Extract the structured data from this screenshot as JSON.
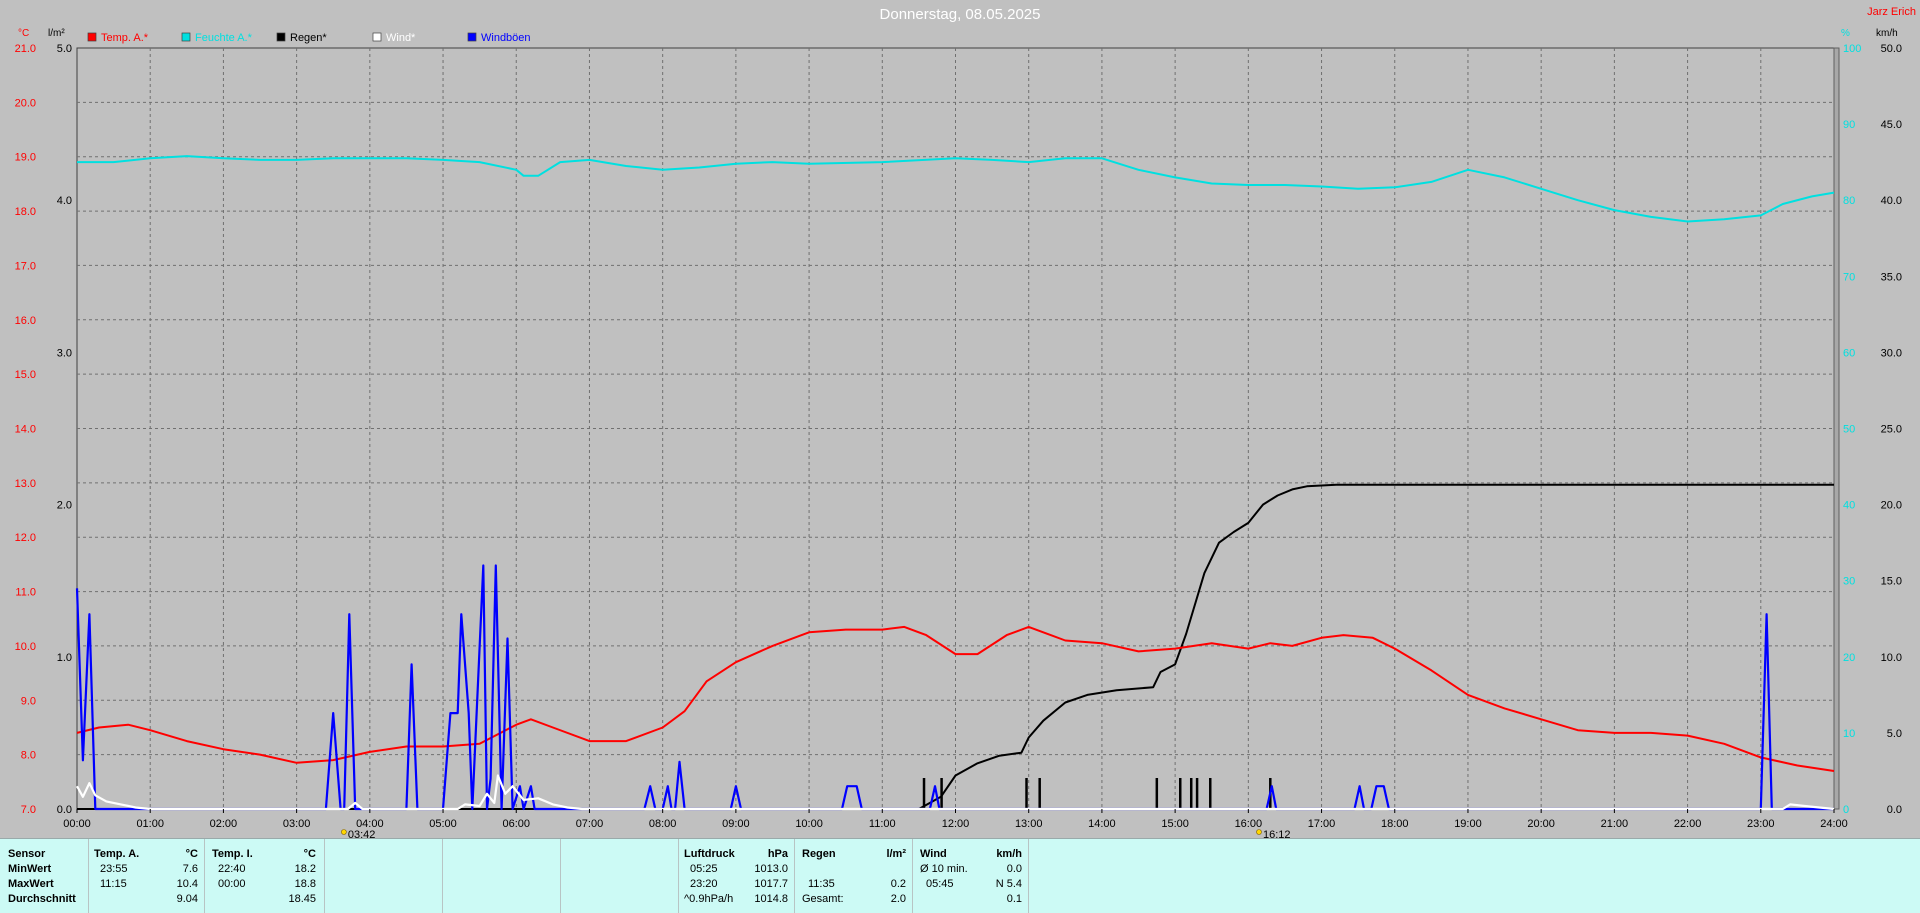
{
  "header": {
    "title": "Donnerstag, 08.05.2025",
    "author": "Jarz Erich"
  },
  "colors": {
    "temp": "#ff0000",
    "humidity": "#00e0e0",
    "rain": "#000000",
    "wind": "#ffffff",
    "gusts": "#0000ff",
    "grid": "#707070",
    "plot_bg": "#c0c0c0",
    "panel_bg": "#ccfaf5"
  },
  "chart_data": {
    "type": "line",
    "title": "Donnerstag, 08.05.2025",
    "x_unit": "hours",
    "xlim": [
      0,
      24
    ],
    "x_ticks": [
      "00:00",
      "01:00",
      "02:00",
      "03:00",
      "04:00",
      "05:00",
      "06:00",
      "07:00",
      "08:00",
      "09:00",
      "10:00",
      "11:00",
      "12:00",
      "13:00",
      "14:00",
      "15:00",
      "16:00",
      "17:00",
      "18:00",
      "19:00",
      "20:00",
      "21:00",
      "22:00",
      "23:00",
      "24:00"
    ],
    "axes": {
      "temp": {
        "unit": "°C",
        "range": [
          7,
          21
        ],
        "ticks": [
          "7.0",
          "8.0",
          "9.0",
          "10.0",
          "11.0",
          "12.0",
          "13.0",
          "14.0",
          "15.0",
          "16.0",
          "17.0",
          "18.0",
          "19.0",
          "20.0",
          "21.0"
        ]
      },
      "rain": {
        "unit": "l/m²",
        "range": [
          0,
          5
        ],
        "ticks": [
          "0.0",
          "1.0",
          "2.0",
          "3.0",
          "4.0",
          "5.0"
        ]
      },
      "humidity": {
        "unit": "%",
        "range": [
          0,
          100
        ],
        "ticks": [
          "0",
          "10",
          "20",
          "30",
          "40",
          "50",
          "60",
          "70",
          "80",
          "90",
          "100"
        ]
      },
      "wind": {
        "unit": "km/h",
        "range": [
          0,
          50
        ],
        "ticks": [
          "0.0",
          "5.0",
          "10.0",
          "15.0",
          "20.0",
          "25.0",
          "30.0",
          "35.0",
          "40.0",
          "45.0",
          "50.0"
        ]
      }
    },
    "grid": true,
    "legend": {
      "placement": "top-left",
      "items": [
        {
          "label": "Temp. A.*",
          "color": "#ff0000"
        },
        {
          "label": "Feuchte A.*",
          "color": "#00e0e0"
        },
        {
          "label": "Regen*",
          "color": "#000000"
        },
        {
          "label": "Wind*",
          "color": "#ffffff"
        },
        {
          "label": "Windböen",
          "color": "#0000ff"
        }
      ]
    },
    "series": [
      {
        "name": "Temp. A.*",
        "axis": "temp",
        "color": "#ff0000",
        "points": [
          [
            0,
            8.4
          ],
          [
            0.3,
            8.5
          ],
          [
            0.7,
            8.55
          ],
          [
            1,
            8.45
          ],
          [
            1.5,
            8.25
          ],
          [
            2,
            8.1
          ],
          [
            2.5,
            8.0
          ],
          [
            3,
            7.85
          ],
          [
            3.5,
            7.9
          ],
          [
            4,
            8.05
          ],
          [
            4.5,
            8.15
          ],
          [
            5,
            8.15
          ],
          [
            5.5,
            8.2
          ],
          [
            6,
            8.55
          ],
          [
            6.2,
            8.65
          ],
          [
            6.5,
            8.5
          ],
          [
            7,
            8.25
          ],
          [
            7.5,
            8.25
          ],
          [
            8,
            8.5
          ],
          [
            8.3,
            8.8
          ],
          [
            8.6,
            9.35
          ],
          [
            9,
            9.7
          ],
          [
            9.5,
            10.0
          ],
          [
            10,
            10.25
          ],
          [
            10.5,
            10.3
          ],
          [
            11,
            10.3
          ],
          [
            11.3,
            10.35
          ],
          [
            11.6,
            10.2
          ],
          [
            12,
            9.85
          ],
          [
            12.3,
            9.85
          ],
          [
            12.7,
            10.2
          ],
          [
            13,
            10.35
          ],
          [
            13.5,
            10.1
          ],
          [
            14,
            10.05
          ],
          [
            14.5,
            9.9
          ],
          [
            15,
            9.95
          ],
          [
            15.5,
            10.05
          ],
          [
            16,
            9.95
          ],
          [
            16.3,
            10.05
          ],
          [
            16.6,
            10.0
          ],
          [
            17,
            10.15
          ],
          [
            17.3,
            10.2
          ],
          [
            17.7,
            10.15
          ],
          [
            18,
            9.95
          ],
          [
            18.5,
            9.55
          ],
          [
            19,
            9.1
          ],
          [
            19.5,
            8.85
          ],
          [
            20,
            8.65
          ],
          [
            20.5,
            8.45
          ],
          [
            21,
            8.4
          ],
          [
            21.5,
            8.4
          ],
          [
            22,
            8.35
          ],
          [
            22.5,
            8.2
          ],
          [
            23,
            7.95
          ],
          [
            23.5,
            7.8
          ],
          [
            24,
            7.7
          ]
        ]
      },
      {
        "name": "Feuchte A.*",
        "axis": "humidity",
        "color": "#00e0e0",
        "points": [
          [
            0,
            85
          ],
          [
            0.5,
            85
          ],
          [
            1,
            85.5
          ],
          [
            1.5,
            85.8
          ],
          [
            2,
            85.5
          ],
          [
            2.5,
            85.3
          ],
          [
            3,
            85.3
          ],
          [
            3.5,
            85.5
          ],
          [
            4,
            85.5
          ],
          [
            4.5,
            85.5
          ],
          [
            5,
            85.3
          ],
          [
            5.5,
            85
          ],
          [
            6,
            84
          ],
          [
            6.1,
            83.2
          ],
          [
            6.3,
            83.2
          ],
          [
            6.6,
            85
          ],
          [
            7,
            85.3
          ],
          [
            7.5,
            84.5
          ],
          [
            8,
            84
          ],
          [
            8.5,
            84.3
          ],
          [
            9,
            84.8
          ],
          [
            9.5,
            85
          ],
          [
            10,
            84.8
          ],
          [
            11,
            85
          ],
          [
            12,
            85.5
          ],
          [
            12.5,
            85.3
          ],
          [
            13,
            85
          ],
          [
            13.5,
            85.5
          ],
          [
            14,
            85.5
          ],
          [
            14.5,
            84
          ],
          [
            15,
            83
          ],
          [
            15.5,
            82.2
          ],
          [
            16,
            82
          ],
          [
            16.5,
            82
          ],
          [
            17,
            81.8
          ],
          [
            17.5,
            81.5
          ],
          [
            18,
            81.7
          ],
          [
            18.5,
            82.4
          ],
          [
            19,
            84
          ],
          [
            19.5,
            83
          ],
          [
            20,
            81.5
          ],
          [
            20.5,
            80
          ],
          [
            21,
            78.7
          ],
          [
            21.5,
            77.8
          ],
          [
            22,
            77.2
          ],
          [
            22.5,
            77.5
          ],
          [
            23,
            78
          ],
          [
            23.3,
            79.5
          ],
          [
            23.7,
            80.5
          ],
          [
            24,
            81
          ]
        ]
      },
      {
        "name": "Regen*",
        "axis": "rain",
        "color": "#000000",
        "points": [
          [
            0,
            0
          ],
          [
            11.5,
            0
          ],
          [
            11.8,
            0.08
          ],
          [
            12,
            0.22
          ],
          [
            12.3,
            0.3
          ],
          [
            12.6,
            0.35
          ],
          [
            12.9,
            0.37
          ],
          [
            13,
            0.47
          ],
          [
            13.2,
            0.58
          ],
          [
            13.5,
            0.7
          ],
          [
            13.8,
            0.75
          ],
          [
            14.2,
            0.78
          ],
          [
            14.7,
            0.8
          ],
          [
            14.8,
            0.9
          ],
          [
            15,
            0.95
          ],
          [
            15.15,
            1.15
          ],
          [
            15.4,
            1.55
          ],
          [
            15.6,
            1.75
          ],
          [
            15.8,
            1.82
          ],
          [
            16,
            1.88
          ],
          [
            16.2,
            2.0
          ],
          [
            16.4,
            2.06
          ],
          [
            16.6,
            2.1
          ],
          [
            16.8,
            2.12
          ],
          [
            17.2,
            2.13
          ],
          [
            24,
            2.13
          ]
        ]
      },
      {
        "name": "Wind*",
        "axis": "wind",
        "color": "#ffffff",
        "points": [
          [
            0,
            1.5
          ],
          [
            0.08,
            0.8
          ],
          [
            0.17,
            1.7
          ],
          [
            0.25,
            0.9
          ],
          [
            0.4,
            0.5
          ],
          [
            0.6,
            0.3
          ],
          [
            0.8,
            0.1
          ],
          [
            1,
            0
          ],
          [
            3.7,
            0
          ],
          [
            3.8,
            0.4
          ],
          [
            3.9,
            0
          ],
          [
            5.2,
            0
          ],
          [
            5.3,
            0.3
          ],
          [
            5.5,
            0.2
          ],
          [
            5.6,
            1.0
          ],
          [
            5.7,
            0.4
          ],
          [
            5.75,
            2.2
          ],
          [
            5.85,
            1.0
          ],
          [
            5.95,
            1.5
          ],
          [
            6.1,
            0.6
          ],
          [
            6.3,
            0.7
          ],
          [
            6.5,
            0.3
          ],
          [
            6.7,
            0.1
          ],
          [
            6.9,
            0
          ],
          [
            23.3,
            0
          ],
          [
            23.4,
            0.3
          ],
          [
            23.6,
            0.2
          ],
          [
            24,
            0
          ]
        ]
      },
      {
        "name": "Windböen",
        "axis": "wind",
        "color": "#0000ff",
        "points": [
          [
            0,
            14.5
          ],
          [
            0.08,
            3.2
          ],
          [
            0.17,
            12.8
          ],
          [
            0.25,
            0
          ],
          [
            3.4,
            0
          ],
          [
            3.5,
            6.3
          ],
          [
            3.6,
            0
          ],
          [
            3.65,
            0
          ],
          [
            3.72,
            12.8
          ],
          [
            3.8,
            0
          ],
          [
            4.5,
            0
          ],
          [
            4.57,
            9.5
          ],
          [
            4.65,
            0
          ],
          [
            5.0,
            0
          ],
          [
            5.1,
            6.3
          ],
          [
            5.2,
            6.3
          ],
          [
            5.25,
            12.8
          ],
          [
            5.35,
            6.3
          ],
          [
            5.4,
            0
          ],
          [
            5.55,
            16
          ],
          [
            5.6,
            0
          ],
          [
            5.65,
            2.0
          ],
          [
            5.72,
            16
          ],
          [
            5.8,
            0
          ],
          [
            5.88,
            11.2
          ],
          [
            5.95,
            0
          ],
          [
            6.05,
            1.5
          ],
          [
            6.1,
            0
          ],
          [
            6.2,
            1.5
          ],
          [
            6.25,
            0
          ],
          [
            7.75,
            0
          ],
          [
            7.83,
            1.5
          ],
          [
            7.9,
            0
          ],
          [
            8.0,
            0
          ],
          [
            8.07,
            1.5
          ],
          [
            8.12,
            0
          ],
          [
            8.17,
            0
          ],
          [
            8.23,
            3.1
          ],
          [
            8.3,
            0
          ],
          [
            8.93,
            0
          ],
          [
            9.0,
            1.5
          ],
          [
            9.07,
            0
          ],
          [
            10.45,
            0
          ],
          [
            10.52,
            1.5
          ],
          [
            10.65,
            1.5
          ],
          [
            10.72,
            0
          ],
          [
            11.65,
            0
          ],
          [
            11.72,
            1.5
          ],
          [
            11.78,
            0
          ],
          [
            16.25,
            0
          ],
          [
            16.32,
            1.5
          ],
          [
            16.38,
            0
          ],
          [
            17.45,
            0
          ],
          [
            17.52,
            1.5
          ],
          [
            17.58,
            0
          ],
          [
            17.68,
            0
          ],
          [
            17.75,
            1.5
          ],
          [
            17.85,
            1.5
          ],
          [
            17.92,
            0
          ],
          [
            23.0,
            0
          ],
          [
            23.08,
            12.8
          ],
          [
            23.15,
            0
          ],
          [
            24,
            0
          ]
        ]
      }
    ],
    "rain_marks": [
      11.57,
      11.81,
      12.97,
      13.15,
      14.75,
      15.07,
      15.22,
      15.3,
      15.48,
      16.3
    ],
    "time_marks": [
      {
        "hour": 3.7,
        "label": "03:42"
      },
      {
        "hour": 16.2,
        "label": "16:12"
      }
    ]
  },
  "stats": {
    "labels": {
      "sensor": "Sensor",
      "min": "MinWert",
      "max": "MaxWert",
      "avg": "Durchschnitt"
    },
    "temp_a": {
      "head": "Temp. A.",
      "unit": "°C",
      "min_time": "23:55",
      "min_val": "7.6",
      "max_time": "11:15",
      "max_val": "10.4",
      "avg_val": "9.04"
    },
    "temp_i": {
      "head": "Temp. I.",
      "unit": "°C",
      "min_time": "22:40",
      "min_val": "18.2",
      "max_time": "00:00",
      "max_val": "18.8",
      "avg_val": "18.45"
    },
    "pressure": {
      "head": "Luftdruck",
      "unit": "hPa",
      "min_time": "05:25",
      "min_val": "1013.0",
      "max_time": "23:20",
      "max_val": "1017.7",
      "trend": "^0.9hPa/h",
      "avg_val": "1014.8"
    },
    "rain": {
      "head": "Regen",
      "unit": "l/m²",
      "max_time": "11:35",
      "max_val": "0.2",
      "total_label": "Gesamt:",
      "total_val": "2.0"
    },
    "wind": {
      "head": "Wind",
      "unit": "km/h",
      "min_time": "Ø 10 min.",
      "min_val": "0.0",
      "max_time": "05:45",
      "max_val": "N 5.4",
      "avg_val": "0.1"
    }
  }
}
